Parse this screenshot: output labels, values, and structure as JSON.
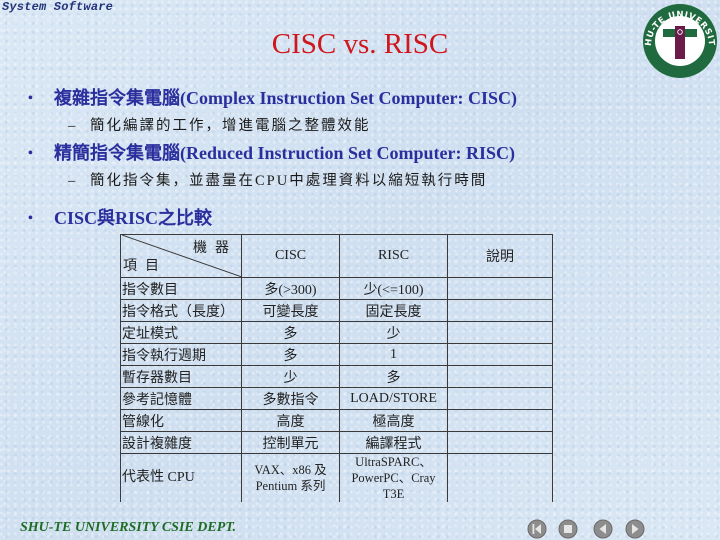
{
  "header": {
    "course_label": "System Software"
  },
  "logo": {
    "text": "SHU-TE UNIVERSITY",
    "colors": {
      "ring": "#1f6a3e",
      "t_bar": "#6b1a4a"
    }
  },
  "slide": {
    "title": "CISC vs. RISC",
    "bullets": [
      {
        "text": "複雜指令集電腦(Complex Instruction Set Computer: CISC)",
        "sub": "簡化編譯的工作，增進電腦之整體效能"
      },
      {
        "text": "精簡指令集電腦(Reduced Instruction Set Computer: RISC)",
        "sub": "簡化指令集，並盡量在CPU中處理資料以縮短執行時間"
      },
      {
        "text": "CISC與RISC之比較"
      }
    ],
    "bullet_symbol": "•",
    "sub_symbol": "–"
  },
  "table": {
    "corner_top": "機器",
    "corner_bottom": "項目",
    "headers": [
      "CISC",
      "RISC",
      "說明"
    ],
    "rows": [
      {
        "item": "指令數目",
        "cisc": "多(>300)",
        "risc": "少(<=100)",
        "note": ""
      },
      {
        "item": "指令格式（長度）",
        "cisc": "可變長度",
        "risc": "固定長度",
        "note": ""
      },
      {
        "item": "定址模式",
        "cisc": "多",
        "risc": "少",
        "note": ""
      },
      {
        "item": "指令執行週期",
        "cisc": "多",
        "risc": "1",
        "note": ""
      },
      {
        "item": "暫存器數目",
        "cisc": "少",
        "risc": "多",
        "note": ""
      },
      {
        "item": "參考記憶體",
        "cisc": "多數指令",
        "risc": "LOAD/STORE",
        "note": ""
      },
      {
        "item": "管線化",
        "cisc": "高度",
        "risc": "極高度",
        "note": ""
      },
      {
        "item": "設計複雜度",
        "cisc": "控制單元",
        "risc": "編譯程式",
        "note": ""
      },
      {
        "item": "代表性 CPU",
        "cisc": "VAX、x86 及 Pentium 系列",
        "risc": "UltraSPARC、PowerPC、Cray T3E",
        "note": ""
      }
    ]
  },
  "footer": {
    "text": "SHU-TE UNIVERSITY CSIE DEPT."
  },
  "nav_buttons": [
    {
      "icon": "first-slide-icon",
      "label": "First"
    },
    {
      "icon": "stop-icon",
      "label": "End"
    },
    {
      "icon": "previous-icon",
      "label": "Previous"
    },
    {
      "icon": "next-icon",
      "label": "Next"
    }
  ],
  "colors": {
    "title": "#d0161d",
    "bullet": "#2b2f9e",
    "footer": "#1e6b24"
  }
}
